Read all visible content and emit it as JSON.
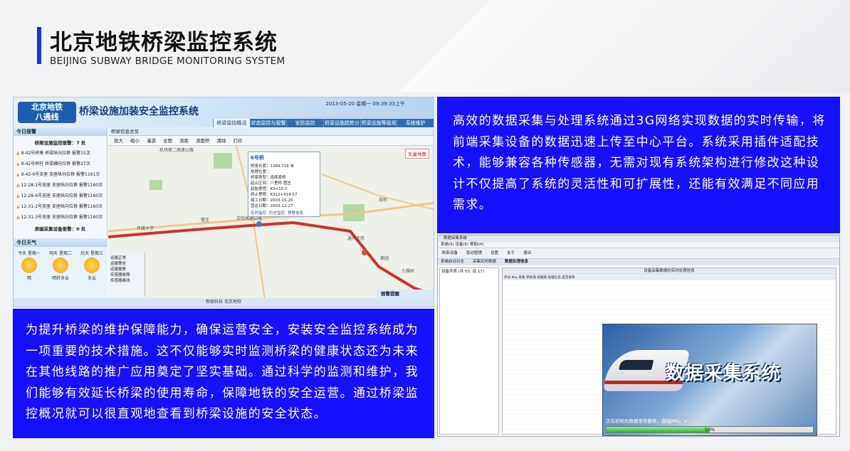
{
  "header": {
    "title": "北京地铁桥梁监控系统",
    "subtitle": "BEIJING SUBWAY BRIDGE MONITORING SYSTEM",
    "accent_color": "#1e2fe0"
  },
  "left_app": {
    "logo_line1": "北京地铁",
    "logo_line2": "八通线",
    "app_title": "桥梁设施加装安全监控系统",
    "datetime": "2013-05-20 星期一 09:39:33上午",
    "nav": [
      "桥梁监控概况",
      "状态监控与报警",
      "安防监控",
      "桥梁设施趋势分析",
      "桥梁设施等级规范",
      "系统维护"
    ],
    "today_alarm": "今日报警",
    "alarm_summary": "桥梁设施监控报警：7 处",
    "alarms": [
      "9-42号桥墩 桥梁纵向位移 报警15次",
      "9-42号桥柱 桥梁横向位移 报警27次",
      "9-42-6号支座 支座纵向位移 报警1161次",
      "12-28-1号支座 支座纵向位移 报警1160次",
      "12-28-6号支座 支座纵向位移 报警1160次",
      "12-31-2号支座 支座纵向位移 报警1160次",
      "12-31-3号支座 支座纵向位移 报警1160次"
    ],
    "security_summary": "肃磁采集设备报警：0 处",
    "weather_title": "今日天气",
    "weather_days": [
      {
        "day": "今天 星期一",
        "desc": "晴"
      },
      {
        "day": "明天 星期二",
        "desc": "晴转多云"
      },
      {
        "day": "后天 星期三",
        "desc": "多云"
      }
    ],
    "map_title": "桥梁信息总览",
    "map_tools": [
      "放大",
      "缩小",
      "漫游",
      "全图",
      "测距",
      "测面积",
      "清除",
      "打印"
    ],
    "popup": {
      "title": "6号桥",
      "lines": [
        "桥梁长度：1269.718 米",
        "地理位置：",
        "桥梁类型：连续梁桥",
        "起止区间：八里桥-管庄",
        "起始里程：K9+10.0",
        "终止里程：K312+914.57",
        "竣工日期：2003-10-20",
        "营运日期：2003-12-27"
      ],
      "buttons": [
        "实时监控",
        "历史监控",
        "预警信息"
      ]
    },
    "legend": [
      "运输正常",
      "运输警告",
      "运输报警",
      "传感器故障",
      "传感器离线"
    ],
    "map_places": [
      "机场第二高速公路",
      "京哈高速公路",
      "通州北苑",
      "果园",
      "九棵树",
      "双桥",
      "传媒大学",
      "管庄"
    ],
    "map_label": "矢量地图",
    "alarm_panel": "报警提醒",
    "footer": "新联科技  北京地铁"
  },
  "box1_text": "为提升桥梁的维护保障能力，确保运营安全，安装安全监控系统成为一项重要的技术措施。这不仅能够实时监测桥梁的健康状态还为未来在其他线路的推广应用奠定了坚实基础。通过科学的监测和维护，我们能够有效延长桥梁的使用寿命，保障地铁的安全运营。通过桥梁监控概况就可以很直观地查看到桥梁设施的安全状态。",
  "box2_text": "高效的数据采集与处理系统通过3G网络实现数据的实时传输，将前端采集设备的数据迅速上传至中心平台。系统采用插件适配技术，能够兼容各种传感器，无需对现有系统架构进行修改这种设计不仅提高了系统的灵活性和可扩展性，还能有效满足不同应用需求。",
  "right_app": {
    "window_title": "数据采集系统",
    "menu": "系统(S)   设备(E)   帮助(H)",
    "tools": [
      "刷新设备",
      "驱动管理",
      "设置",
      "关于",
      "退出"
    ],
    "tabs": [
      "系统启动日志",
      "采集实时数据",
      "数据处理信息"
    ],
    "tree_header": "设备列表 (共 55, 连 17)",
    "grid_title": "设备采集数据的实时处理信息",
    "grid_cols": "序号   Key   采集   原始值   处理值   处理信息   是否发布",
    "splash_title": "数据采集系统",
    "splash_msg": "正在初始化数据发布服务，连接JMS。>",
    "progress": 50,
    "progress_label": "50%"
  }
}
